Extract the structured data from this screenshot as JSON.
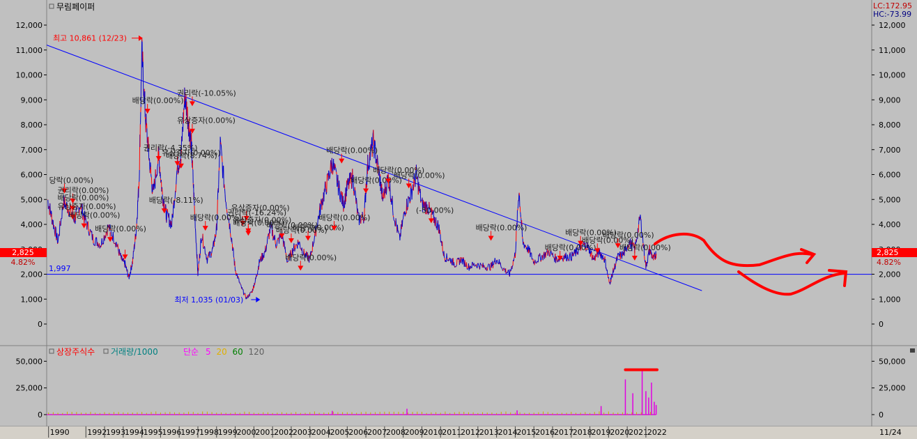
{
  "panel_title": "무림페이퍼",
  "lc_label": "LC:172.95",
  "hc_label": "HC:-73.99",
  "price_marker": "2,825",
  "pct_marker": "4.82%",
  "pct_marker_right": "4.82%",
  "support_label": "1,997",
  "right_footer": "11/24",
  "colors": {
    "price_line": "#0000cc",
    "price_red": "#ff0000",
    "trend": "#0000ff",
    "annot_red": "#ff0000",
    "bg": "#c0c0c0"
  },
  "volume_legend": [
    {
      "text": "상장주식수",
      "color": "#ff0000"
    },
    {
      "text": "거래량/1000",
      "color": "#008080"
    },
    {
      "text": "단순",
      "color": "#ff00ff"
    },
    {
      "text": "5",
      "color": "#ff00ff"
    },
    {
      "text": "20",
      "color": "#e0b000"
    },
    {
      "text": "60",
      "color": "#008000"
    },
    {
      "text": "120",
      "color": "#606060"
    }
  ],
  "chart_data": {
    "type": "line",
    "x_range": [
      1989.9,
      2022.6
    ],
    "y_range": [
      0,
      12000
    ],
    "y_ticks": [
      0,
      1000,
      2000,
      3000,
      4000,
      5000,
      6000,
      7000,
      8000,
      9000,
      10000,
      11000,
      12000
    ],
    "y_tick_labels": [
      "0",
      "1,000",
      "2,000",
      "3,000",
      "4,000",
      "5,000",
      "6,000",
      "7,000",
      "8,000",
      "9,000",
      "10,000",
      "11,000",
      "12,000"
    ],
    "x_tick_labels": [
      "1990",
      "1992",
      "1993",
      "1994",
      "1995",
      "1996",
      "1997",
      "1998",
      "1999",
      "2000",
      "2001",
      "2002",
      "2003",
      "2004",
      "2005",
      "2006",
      "2007",
      "2008",
      "2009",
      "2010",
      "2011",
      "2012",
      "2013",
      "2014",
      "2015",
      "2016",
      "2017",
      "2018",
      "2019",
      "2020",
      "2021",
      "2022"
    ],
    "x_tick_years": [
      1990,
      1992,
      1993,
      1994,
      1995,
      1996,
      1997,
      1998,
      1999,
      2000,
      2001,
      2002,
      2003,
      2004,
      2005,
      2006,
      2007,
      2008,
      2009,
      2010,
      2011,
      2012,
      2013,
      2014,
      2015,
      2016,
      2017,
      2018,
      2019,
      2020,
      2021,
      2022
    ],
    "series": [
      {
        "x": [
          1989.95,
          1990.2,
          1990.5,
          1990.8,
          1991.1,
          1991.4,
          1991.7,
          1992.0,
          1992.4,
          1992.8,
          1993.2,
          1993.6,
          1993.9,
          1994.1,
          1994.3,
          1994.5,
          1994.7,
          1994.85,
          1995.0,
          1995.2,
          1995.4,
          1995.6,
          1995.9,
          1996.1,
          1996.3,
          1996.6,
          1996.9,
          1997.1,
          1997.3,
          1997.5,
          1997.65,
          1997.8,
          1998.0,
          1998.2,
          1998.5,
          1998.8,
          1999.0,
          1999.2,
          1999.5,
          1999.8,
          2000.0,
          2000.3,
          2000.6,
          2000.9,
          2001.1,
          2001.3,
          2001.6,
          2001.9,
          2002.2,
          2002.5,
          2002.8,
          2003.1,
          2003.4,
          2003.7,
          2004.0,
          2004.3,
          2004.6,
          2004.9,
          2005.2,
          2005.5,
          2005.8,
          2006.0,
          2006.3,
          2006.6,
          2006.9,
          2007.1,
          2007.4,
          2007.7,
          2007.9,
          2008.2,
          2008.5,
          2008.8,
          2009.1,
          2009.4,
          2009.7,
          2010.0,
          2010.3,
          2010.6,
          2010.9,
          2011.2,
          2011.5,
          2011.8,
          2012.1,
          2012.5,
          2012.9,
          2013.3,
          2013.7,
          2014.0,
          2014.4,
          2014.7,
          2015.0,
          2015.2,
          2015.4,
          2015.7,
          2016.0,
          2016.4,
          2016.8,
          2017.2,
          2017.6,
          2018.0,
          2018.3,
          2018.6,
          2018.9,
          2019.2,
          2019.5,
          2019.8,
          2020.05,
          2020.2,
          2020.5,
          2020.8,
          2021.1,
          2021.4,
          2021.7,
          2022.0,
          2022.2,
          2022.4,
          2022.55
        ],
        "y": [
          5000,
          4200,
          3300,
          4900,
          4600,
          4200,
          4800,
          4100,
          3400,
          3200,
          3900,
          3300,
          2600,
          2400,
          1850,
          2500,
          3800,
          5800,
          10861,
          8200,
          6600,
          5200,
          6800,
          5200,
          4400,
          4000,
          6300,
          6800,
          9200,
          8100,
          7200,
          4900,
          2000,
          3600,
          2600,
          3000,
          3800,
          7200,
          5000,
          3500,
          2200,
          1500,
          1035,
          1300,
          1800,
          2500,
          2900,
          3900,
          3200,
          3600,
          2500,
          3000,
          3300,
          2800,
          2600,
          3700,
          4800,
          5600,
          6500,
          5600,
          4800,
          5500,
          5900,
          4200,
          4300,
          6400,
          7300,
          6100,
          5000,
          5900,
          4400,
          3400,
          4600,
          5200,
          6000,
          4800,
          4700,
          4300,
          3900,
          2700,
          2600,
          2400,
          2600,
          2300,
          2400,
          2300,
          2300,
          2600,
          2200,
          2000,
          2800,
          5400,
          3300,
          3000,
          2500,
          2700,
          2900,
          2600,
          2700,
          2700,
          2900,
          3200,
          3100,
          2600,
          2900,
          2600,
          1600,
          2000,
          2700,
          2800,
          3300,
          3000,
          4300,
          2300,
          3000,
          2600,
          2825
        ]
      }
    ],
    "trend_line": {
      "x": [
        1989.9,
        2022.6,
        2025.0
      ],
      "y": [
        11200,
        3900,
        1340
      ]
    },
    "support_line": {
      "y": 1997
    },
    "annotations": [
      {
        "x": 1994.9,
        "y": 10861,
        "text": "최고 10,861 (12/23)",
        "color": "#ff0000"
      },
      {
        "x": 2001.7,
        "y": 1035,
        "text": "최저 1,035 (01/03)",
        "color": "#0000ff"
      }
    ],
    "event_markers": [
      {
        "x": 1990.85,
        "y": 5300,
        "text": "당락(0.00%)"
      },
      {
        "x": 1991.3,
        "y": 4900,
        "text": "권리락(0.00%)"
      },
      {
        "x": 1991.3,
        "y": 4600,
        "text": "배당락(0.00%)"
      },
      {
        "x": 1991.3,
        "y": 4250,
        "text": "유상증자(0.00%)"
      },
      {
        "x": 1991.9,
        "y": 3900,
        "text": "배당락(0.00%)"
      },
      {
        "x": 1993.3,
        "y": 3350,
        "text": "배당락(0.00%)"
      },
      {
        "x": 1994.1,
        "y": 2650,
        "text": ""
      },
      {
        "x": 1995.3,
        "y": 8500,
        "text": "배당락(0.00%)"
      },
      {
        "x": 1997.7,
        "y": 8800,
        "text": "권리락(-10.05%)"
      },
      {
        "x": 1997.7,
        "y": 7700,
        "text": "유상증자(0.00%)"
      },
      {
        "x": 1996.9,
        "y": 6400,
        "text": "유상증자(0.00%)"
      },
      {
        "x": 1997.1,
        "y": 6300,
        "text": "배당락(8.74%)"
      },
      {
        "x": 1995.9,
        "y": 6600,
        "text": "권리락(-4.35%)"
      },
      {
        "x": 1996.2,
        "y": 4500,
        "text": "배당락(-8.11%)"
      },
      {
        "x": 1998.4,
        "y": 3800,
        "text": "배당락(0.00%)"
      },
      {
        "x": 2000.6,
        "y": 4200,
        "text": "유상증자(0.00%)"
      },
      {
        "x": 2000.4,
        "y": 4000,
        "text": "권리락(-16.24%)"
      },
      {
        "x": 2000.7,
        "y": 3700,
        "text": "유상증자(0.00%)"
      },
      {
        "x": 2000.7,
        "y": 3600,
        "text": "배당락(0.00%)"
      },
      {
        "x": 2002.5,
        "y": 3500,
        "text": "배당락(0.00%)"
      },
      {
        "x": 2003.0,
        "y": 3300,
        "text": "배당락(0.00%)"
      },
      {
        "x": 2003.9,
        "y": 3400,
        "text": "배당락(0.00%)"
      },
      {
        "x": 2003.5,
        "y": 2200,
        "text": "배당락(0.00%)"
      },
      {
        "x": 2005.3,
        "y": 3800,
        "text": "배당락(0.00%)"
      },
      {
        "x": 2005.7,
        "y": 6500,
        "text": "배당락(0.00%)"
      },
      {
        "x": 2007.0,
        "y": 5300,
        "text": "배당락(0.00%)"
      },
      {
        "x": 2008.2,
        "y": 5700,
        "text": "배당락(0.00%)"
      },
      {
        "x": 2009.3,
        "y": 5500,
        "text": "배당락(0.00%)"
      },
      {
        "x": 2010.5,
        "y": 4100,
        "text": "(-50.00%)"
      },
      {
        "x": 2013.7,
        "y": 3400,
        "text": "배당락(0.00%)"
      },
      {
        "x": 2017.4,
        "y": 2600,
        "text": "배당락(0.00%)"
      },
      {
        "x": 2018.5,
        "y": 3200,
        "text": "배당락(0.00%)"
      },
      {
        "x": 2019.4,
        "y": 2900,
        "text": "배당락(0.00%)"
      },
      {
        "x": 2020.5,
        "y": 3100,
        "text": "배당락(0.00%)"
      },
      {
        "x": 2021.4,
        "y": 2600,
        "text": "배당락(0.00%)"
      }
    ],
    "volume": {
      "y_range": [
        0,
        62000
      ],
      "y_ticks": [
        0,
        25000,
        50000
      ],
      "y_tick_labels": [
        "0",
        "25,000",
        "50,000"
      ],
      "spikes": [
        {
          "x": 2019.6,
          "v": 8000
        },
        {
          "x": 2020.9,
          "v": 33000
        },
        {
          "x": 2021.3,
          "v": 20000
        },
        {
          "x": 2021.8,
          "v": 42000
        },
        {
          "x": 2022.0,
          "v": 22000
        },
        {
          "x": 2022.15,
          "v": 16000
        },
        {
          "x": 2022.3,
          "v": 30000
        },
        {
          "x": 2022.45,
          "v": 12000
        },
        {
          "x": 2022.55,
          "v": 9000
        },
        {
          "x": 2005.2,
          "v": 3500
        },
        {
          "x": 2009.2,
          "v": 5500
        },
        {
          "x": 2015.1,
          "v": 4000
        }
      ],
      "overlay_line_y": 42000
    }
  }
}
